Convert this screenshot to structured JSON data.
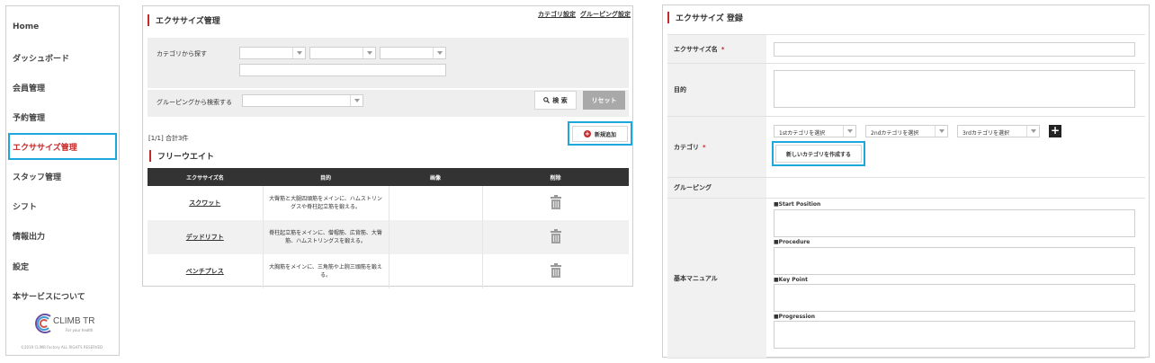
{
  "sidebar": {
    "items": [
      {
        "label": "Home"
      },
      {
        "label": "ダッシュボード"
      },
      {
        "label": "会員管理"
      },
      {
        "label": "予約管理"
      },
      {
        "label": "エクササイズ管理"
      },
      {
        "label": "スタッフ管理"
      },
      {
        "label": "シフト"
      },
      {
        "label": "情報出力"
      },
      {
        "label": "設定"
      },
      {
        "label": "本サービスについて"
      }
    ],
    "logo_text": "CLIMB TR",
    "logo_sub": "For your health",
    "copyright": "©2019 CLIMB Factory ALL RIGHTS RESERVED"
  },
  "list_panel": {
    "title": "エクササイズ管理",
    "links": [
      "カテゴリ設定",
      "グルーピング設定"
    ],
    "search": {
      "category_label": "カテゴリから探す",
      "grouping_label": "グルーピングから検索する",
      "search_button": "検 索",
      "reset_button": "リセット"
    },
    "count": "[1/1] 合計3件",
    "add_button": "新規追加",
    "section": "フリーウエイト",
    "columns": [
      "エクササイズ名",
      "目的",
      "画像",
      "削除"
    ],
    "rows": [
      {
        "name": "スクワット",
        "purpose": "大臀筋と大腿四頭筋をメインに、ハムストリングスや脊柱起立筋を鍛える。"
      },
      {
        "name": "デッドリフト",
        "purpose": "脊柱起立筋をメインに、僧帽筋、広背筋、大臀筋、ハムストリングスを鍛える。"
      },
      {
        "name": "ベンチプレス",
        "purpose": "大胸筋をメインに、三角筋や上腕三頭筋を鍛える。"
      }
    ]
  },
  "register_panel": {
    "title": "エクササイズ 登録",
    "fields": {
      "name_label": "エクササイズ名",
      "purpose_label": "目的",
      "category_label": "カテゴリ",
      "grouping_label": "グルーピング",
      "manual_label": "基本マニュアル"
    },
    "required_mark": "*",
    "category_selects": [
      "1stカテゴリを選択",
      "2ndカテゴリを選択",
      "3rdカテゴリを選択"
    ],
    "new_category_button": "新しいカテゴリを作成する",
    "manual_sections": [
      "■Start Position",
      "■Procedure",
      "■Key Point",
      "■Progression"
    ]
  },
  "colors": {
    "accent": "#c52a2a",
    "highlight": "#1ea7dc",
    "table_header": "#333333"
  }
}
